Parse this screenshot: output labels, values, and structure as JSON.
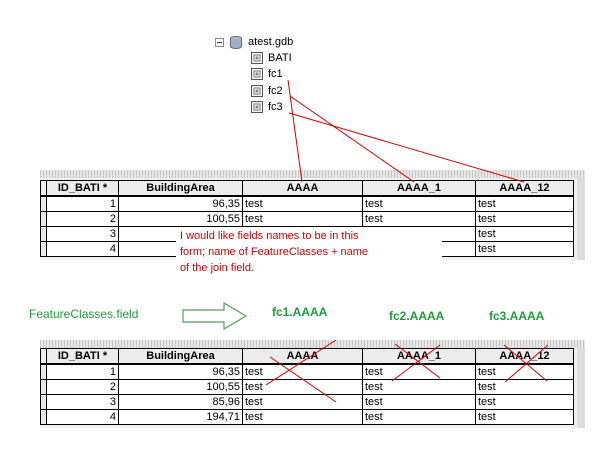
{
  "tree": {
    "root_label": "atest.gdb",
    "items": [
      "BATI",
      "fc1",
      "fc2",
      "fc3"
    ]
  },
  "table1": {
    "headers": [
      "ID_BATI *",
      "BuildingArea",
      "AAAA",
      "AAAA_1",
      "AAAA_12"
    ],
    "rows": [
      [
        "1",
        "96,35",
        "test",
        "test",
        "test"
      ],
      [
        "2",
        "100,55",
        "test",
        "test",
        "test"
      ],
      [
        "3",
        "",
        "",
        "",
        "test"
      ],
      [
        "4",
        "",
        "",
        "",
        "test"
      ]
    ]
  },
  "table2": {
    "headers": [
      "ID_BATI *",
      "BuildingArea",
      "AAAA",
      "AAAA_1",
      "AAAA_12"
    ],
    "rows": [
      [
        "1",
        "96,35",
        "test",
        "test",
        "test"
      ],
      [
        "2",
        "100,55",
        "test",
        "test",
        "test"
      ],
      [
        "3",
        "85,96",
        "test",
        "test",
        "test"
      ],
      [
        "4",
        "194,71",
        "test",
        "test",
        "test"
      ]
    ]
  },
  "annotation": {
    "line1": "I would like fields names to be in this",
    "line2": "form; name of FeatureClasses + name",
    "line3": "of the join field."
  },
  "labels": {
    "feature_field": "FeatureClasses.field",
    "fc1": "fc1.AAAA",
    "fc2": "fc2.AAAA",
    "fc3": "fc3.AAAA"
  },
  "colors": {
    "annotation_red": "#d40000",
    "annotation_green": "#1f9b3a"
  }
}
